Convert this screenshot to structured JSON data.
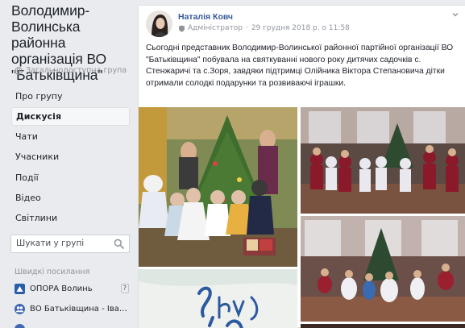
{
  "group": {
    "title": "Володимир-Волинська районна організація ВО \"Батьківщина\"",
    "privacy": "Загальнодоступна група"
  },
  "nav": {
    "items": [
      {
        "label": "Про групу",
        "active": false
      },
      {
        "label": "Дискусія",
        "active": true
      },
      {
        "label": "Чати",
        "active": false
      },
      {
        "label": "Учасники",
        "active": false
      },
      {
        "label": "Події",
        "active": false
      },
      {
        "label": "Відео",
        "active": false
      },
      {
        "label": "Світлини",
        "active": false
      }
    ]
  },
  "search": {
    "placeholder": "Шукати у групі",
    "icon": "search-icon"
  },
  "shortcuts": {
    "heading": "Швидкі посилання",
    "items": [
      {
        "label": "ОПОРА Волинь",
        "badge": "?",
        "icon": "triangle-flag-icon",
        "color": "#2a5ea8"
      },
      {
        "label": "ВО Батьківщина - Іван...",
        "badge": "",
        "icon": "group-icon",
        "color": "#4267b2"
      }
    ]
  },
  "post": {
    "author": "Наталія Ковч",
    "role": "Адміністратор",
    "date": "29 грудня 2018 р. о 11:58",
    "text": "Сьогодні представник Володимир-Волинської районної партійної організації ВО \"Батьківщина\" побувала на святкуванні нового року дитячих садочків с. Стенжаричі та с.Зоря, завдяки підтримці Олійника Віктора Степановича дітки отримали солодкі подарунки та розвиваючі іграшки."
  },
  "colors": {
    "link": "#365899",
    "background": "#e9ebee",
    "muted": "#90949c"
  }
}
